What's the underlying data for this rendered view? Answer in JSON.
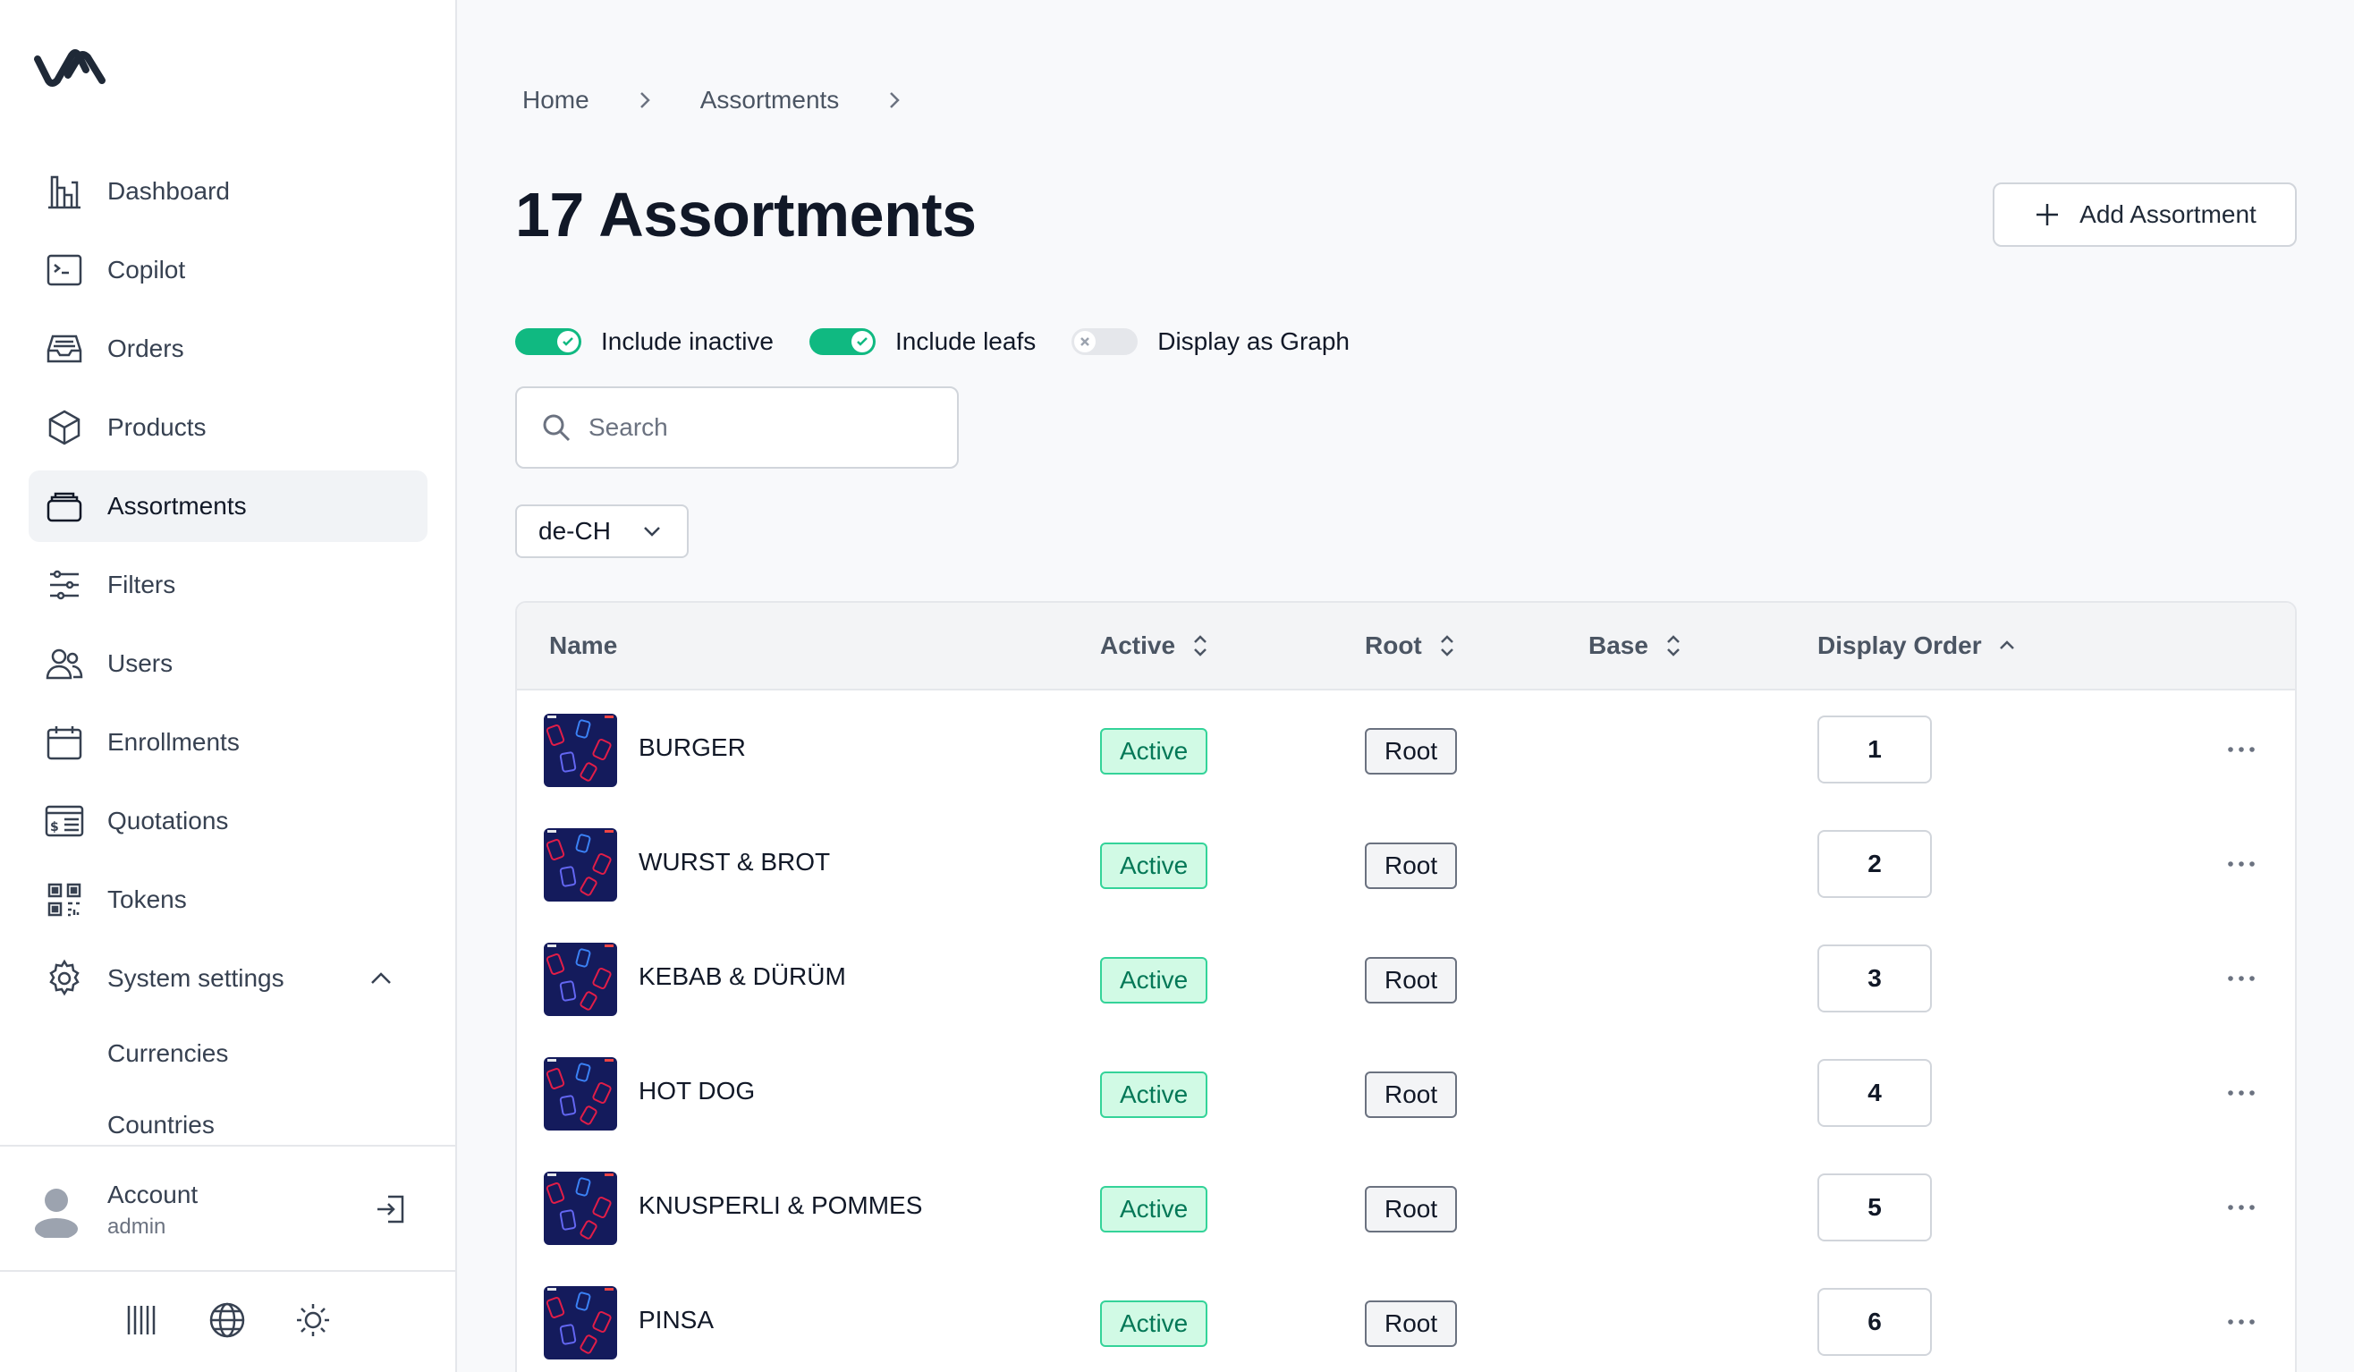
{
  "sidebar": {
    "items": [
      {
        "label": "Dashboard",
        "icon": "dashboard-icon"
      },
      {
        "label": "Copilot",
        "icon": "terminal-icon"
      },
      {
        "label": "Orders",
        "icon": "inbox-icon"
      },
      {
        "label": "Products",
        "icon": "cube-icon"
      },
      {
        "label": "Assortments",
        "icon": "stack-icon"
      },
      {
        "label": "Filters",
        "icon": "sliders-icon"
      },
      {
        "label": "Users",
        "icon": "users-icon"
      },
      {
        "label": "Enrollments",
        "icon": "calendar-icon"
      },
      {
        "label": "Quotations",
        "icon": "quotation-icon"
      },
      {
        "label": "Tokens",
        "icon": "qrcode-icon"
      },
      {
        "label": "System settings",
        "icon": "gear-icon"
      }
    ],
    "sub_items": [
      "Currencies",
      "Countries"
    ],
    "account": {
      "name": "Account",
      "role": "admin"
    }
  },
  "breadcrumb": [
    "Home",
    "Assortments"
  ],
  "page": {
    "title": "17 Assortments",
    "add_button": "Add Assortment"
  },
  "toggles": {
    "include_inactive": {
      "label": "Include inactive",
      "on": true
    },
    "include_leafs": {
      "label": "Include leafs",
      "on": true
    },
    "display_graph": {
      "label": "Display as Graph",
      "on": false
    }
  },
  "search": {
    "placeholder": "Search",
    "value": ""
  },
  "locale": {
    "value": "de-CH"
  },
  "table": {
    "columns": [
      "Name",
      "Active",
      "Root",
      "Base",
      "Display Order"
    ],
    "rows": [
      {
        "name": "BURGER",
        "active": "Active",
        "root": "Root",
        "order": "1"
      },
      {
        "name": "WURST & BROT",
        "active": "Active",
        "root": "Root",
        "order": "2"
      },
      {
        "name": "KEBAB & DÜRÜM",
        "active": "Active",
        "root": "Root",
        "order": "3"
      },
      {
        "name": "HOT DOG",
        "active": "Active",
        "root": "Root",
        "order": "4"
      },
      {
        "name": "KNUSPERLI & POMMES",
        "active": "Active",
        "root": "Root",
        "order": "5"
      },
      {
        "name": "PINSA",
        "active": "Active",
        "root": "Root",
        "order": "6"
      }
    ]
  },
  "colors": {
    "accent": "#10b981",
    "active_bg": "#d1fae5",
    "active_text": "#047857",
    "thumb_bg": "#141b5c"
  }
}
